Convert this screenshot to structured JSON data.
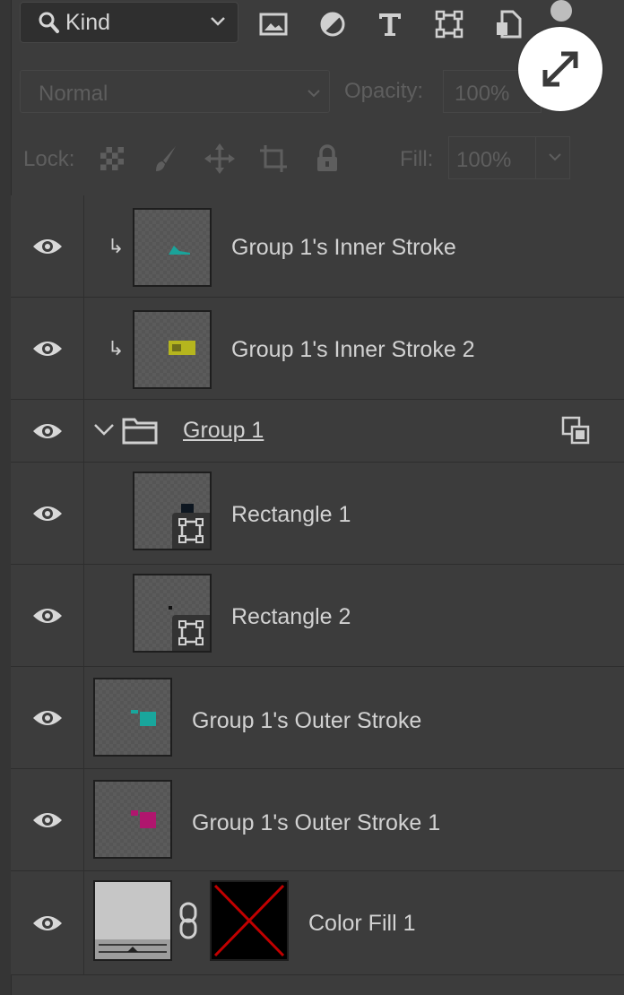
{
  "toolbar": {
    "filter_kind": "Kind",
    "blend_mode": "Normal",
    "opacity_label": "Opacity:",
    "opacity_value": "100%",
    "lock_label": "Lock:",
    "fill_label": "Fill:",
    "fill_value": "100%"
  },
  "filter_icons": [
    "image-filter-icon",
    "adjustment-filter-icon",
    "type-filter-icon",
    "shape-filter-icon",
    "smart-object-filter-icon"
  ],
  "lock_icons": [
    "lock-transparent-pixels-icon",
    "lock-image-pixels-icon",
    "lock-position-icon",
    "lock-artboard-icon",
    "lock-all-icon"
  ],
  "layers": [
    {
      "name": "Group 1's Inner Stroke",
      "clipped": true,
      "thumb_color": "#1aa39a"
    },
    {
      "name": "Group 1's Inner Stroke 2",
      "clipped": true,
      "thumb_color": "#b5b51e"
    },
    {
      "name": "Group 1",
      "type": "group",
      "expanded": true
    },
    {
      "name": "Rectangle 1",
      "type": "shape",
      "thumb_color": "#0d1620"
    },
    {
      "name": "Rectangle 2",
      "type": "shape",
      "thumb_color": "#111111"
    },
    {
      "name": "Group 1's Outer Stroke",
      "thumb_color": "#19a69c"
    },
    {
      "name": "Group 1's Outer Stroke 1",
      "thumb_color": "#b0166e"
    },
    {
      "name": "Color Fill 1",
      "type": "fill",
      "has_mask": true,
      "mask_color": "#c00000"
    }
  ]
}
